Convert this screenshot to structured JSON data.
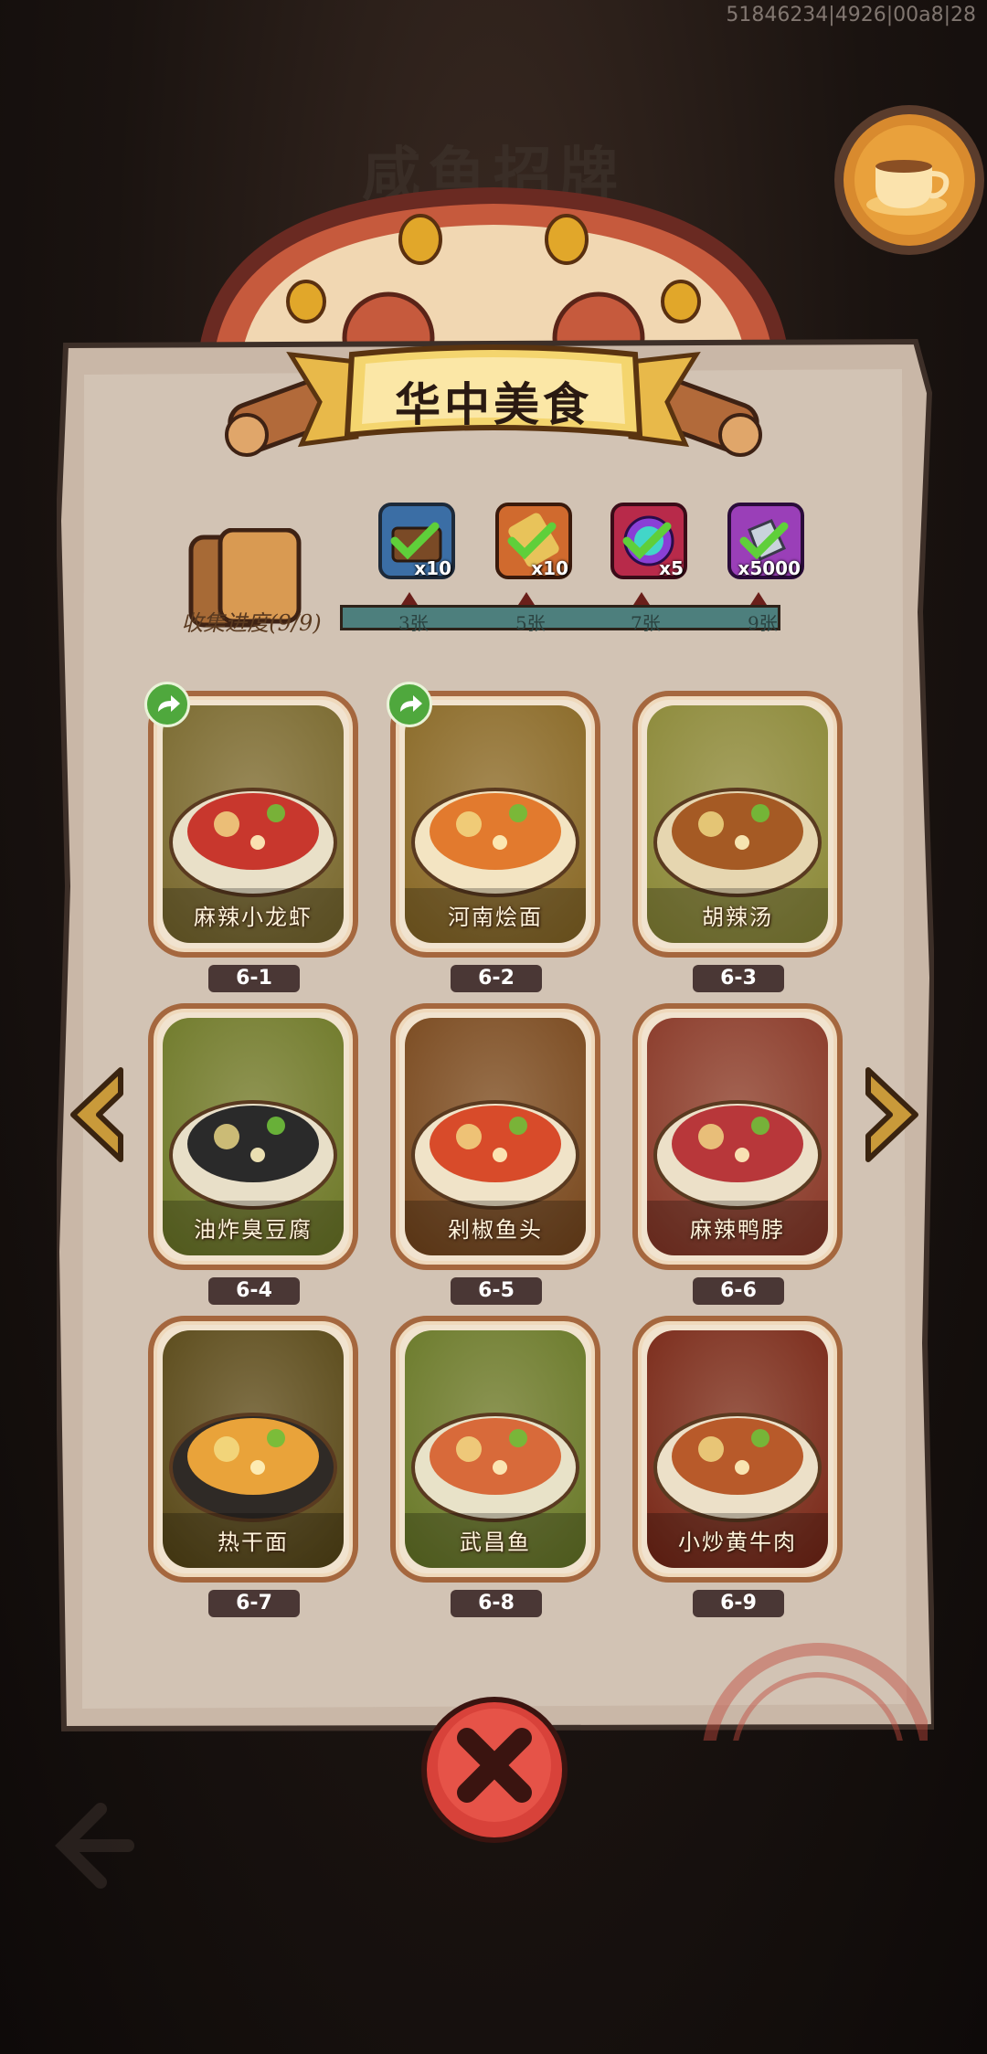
{
  "debug_id": "51846234|4926|00a8|28",
  "background": {
    "title": "咸鱼招牌"
  },
  "album": {
    "title": "华中美食",
    "progress_label": "收集进度(9/9)",
    "rewards": [
      {
        "icon": "treasure-chest-icon",
        "count": "x10",
        "claimed": true
      },
      {
        "icon": "scroll-ticket-icon",
        "count": "x10",
        "claimed": true
      },
      {
        "icon": "purple-orb-icon",
        "count": "x5",
        "claimed": true
      },
      {
        "icon": "silver-crystal-icon",
        "count": "x5000",
        "claimed": true
      }
    ],
    "milestones": [
      "3张",
      "5张",
      "7张",
      "9张"
    ],
    "cards": [
      {
        "id": "6-1",
        "name": "麻辣小龙虾",
        "shareable": true
      },
      {
        "id": "6-2",
        "name": "河南烩面",
        "shareable": true
      },
      {
        "id": "6-3",
        "name": "胡辣汤",
        "shareable": false
      },
      {
        "id": "6-4",
        "name": "油炸臭豆腐",
        "shareable": false
      },
      {
        "id": "6-5",
        "name": "剁椒鱼头",
        "shareable": false
      },
      {
        "id": "6-6",
        "name": "麻辣鸭脖",
        "shareable": false
      },
      {
        "id": "6-7",
        "name": "热干面",
        "shareable": false
      },
      {
        "id": "6-8",
        "name": "武昌鱼",
        "shareable": false
      },
      {
        "id": "6-9",
        "name": "小炒黄牛肉",
        "shareable": false
      }
    ]
  },
  "colors": {
    "accent_red": "#d8423a",
    "card_border": "#a5673e",
    "progress_track": "#4d7f7d",
    "share_green": "#4fa83d"
  }
}
